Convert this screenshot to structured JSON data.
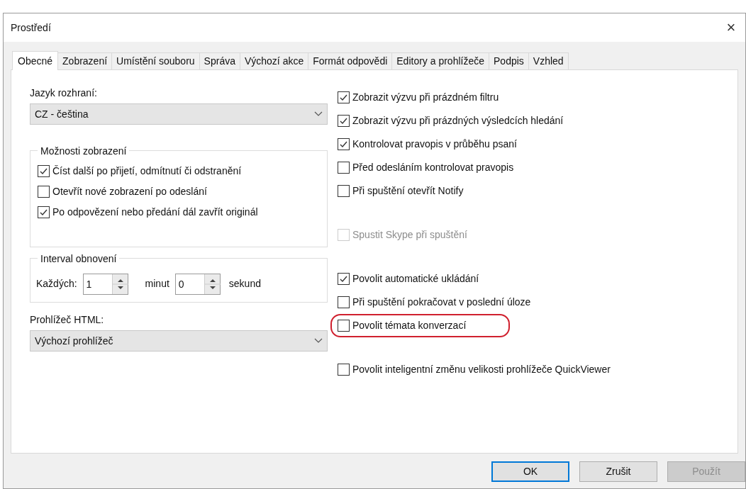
{
  "window": {
    "title": "Prostředí",
    "close": "×"
  },
  "tabs": [
    {
      "label": "Obecné",
      "selected": true
    },
    {
      "label": "Zobrazení",
      "selected": false
    },
    {
      "label": "Umístění souboru",
      "selected": false
    },
    {
      "label": "Správa",
      "selected": false
    },
    {
      "label": "Výchozí akce",
      "selected": false
    },
    {
      "label": "Formát odpovědi",
      "selected": false
    },
    {
      "label": "Editory a prohlížeče",
      "selected": false
    },
    {
      "label": "Podpis",
      "selected": false
    },
    {
      "label": "Vzhled",
      "selected": false
    }
  ],
  "language": {
    "label": "Jazyk rozhraní:",
    "value": "CZ - čeština"
  },
  "display_options": {
    "title": "Možnosti zobrazení",
    "items": [
      {
        "label": "Číst další po přijetí, odmítnutí či odstranění",
        "checked": true
      },
      {
        "label": "Otevřít nové zobrazení po odeslání",
        "checked": false
      },
      {
        "label": "Po odpovězení nebo předání dál zavřít originál",
        "checked": true
      }
    ]
  },
  "refresh_interval": {
    "title": "Interval obnovení",
    "every_label": "Každých:",
    "minutes": "1",
    "minutes_label": "minut",
    "seconds": "0",
    "seconds_label": "sekund"
  },
  "html_viewer": {
    "label": "Prohlížeč HTML:",
    "value": "Výchozí prohlížeč"
  },
  "right_options": [
    [
      {
        "label": "Zobrazit výzvu při prázdném filtru",
        "checked": true,
        "disabled": false,
        "highlighted": false
      },
      {
        "label": "Zobrazit výzvu při prázdných výsledcích hledání",
        "checked": true,
        "disabled": false,
        "highlighted": false
      },
      {
        "label": "Kontrolovat pravopis v průběhu psaní",
        "checked": true,
        "disabled": false,
        "highlighted": false
      },
      {
        "label": "Před odesláním kontrolovat pravopis",
        "checked": false,
        "disabled": false,
        "highlighted": false
      },
      {
        "label": "Při spuštění otevřít Notify",
        "checked": false,
        "disabled": false,
        "highlighted": false
      }
    ],
    [
      {
        "label": "Spustit Skype při spuštění",
        "checked": false,
        "disabled": true,
        "highlighted": false
      }
    ],
    [
      {
        "label": "Povolit automatické ukládání",
        "checked": true,
        "disabled": false,
        "highlighted": false
      },
      {
        "label": "Při spuštění pokračovat v poslední úloze",
        "checked": false,
        "disabled": false,
        "highlighted": false
      },
      {
        "label": "Povolit témata konverzací",
        "checked": false,
        "disabled": false,
        "highlighted": true
      }
    ],
    [
      {
        "label": "Povolit inteligentní změnu velikosti prohlížeče QuickViewer",
        "checked": false,
        "disabled": false,
        "highlighted": false
      }
    ]
  ],
  "buttons": [
    {
      "label": "OK",
      "kind": "default",
      "disabled": false
    },
    {
      "label": "Zrušit",
      "kind": "normal",
      "disabled": false
    },
    {
      "label": "Použít",
      "kind": "normal",
      "disabled": true
    }
  ]
}
